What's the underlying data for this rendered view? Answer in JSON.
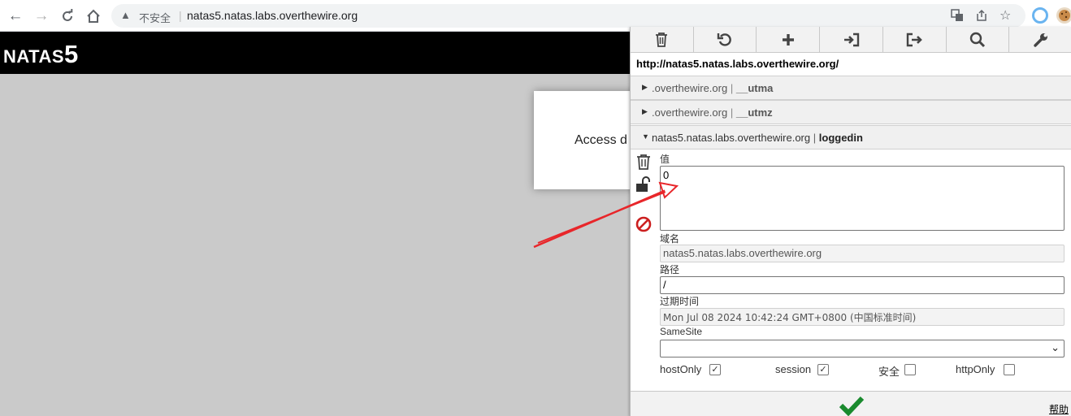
{
  "browser": {
    "security_label": "不安全",
    "url": "natas5.natas.labs.overthewire.org",
    "icons": [
      "back-icon",
      "forward-icon",
      "reload-icon",
      "home-icon",
      "warning-icon",
      "translate-icon",
      "share-icon",
      "star-icon",
      "extension-icon",
      "cookie-icon"
    ]
  },
  "page": {
    "title_prefix": "NATAS",
    "title_number": "5",
    "content_text": "Access d"
  },
  "cookie_editor": {
    "toolbar_icons": [
      "trash-icon",
      "undo-icon",
      "plus-icon",
      "import-icon",
      "export-icon",
      "search-icon",
      "wrench-icon"
    ],
    "current_url": "http://natas5.natas.labs.overthewire.org/",
    "cookies": [
      {
        "domain": ".overthewire.org",
        "sep": "|",
        "name": "__utma",
        "expanded": false
      },
      {
        "domain": ".overthewire.org",
        "sep": "|",
        "name": "__utmz",
        "expanded": false
      },
      {
        "domain": "natas5.natas.labs.overthewire.org",
        "sep": "|",
        "name": "loggedin",
        "expanded": true
      }
    ],
    "editor": {
      "value_label": "值",
      "value": "0",
      "domain_label": "域名",
      "domain": "natas5.natas.labs.overthewire.org",
      "path_label": "路径",
      "path": "/",
      "expires_label": "过期时间",
      "expires": "Mon Jul 08 2024 10:42:24 GMT+0800 (中国标准时间)",
      "samesite_label": "SameSite",
      "samesite": "",
      "flags": [
        {
          "label": "hostOnly",
          "checked": true
        },
        {
          "label": "session",
          "checked": true
        },
        {
          "label": "安全",
          "checked": false
        },
        {
          "label": "httpOnly",
          "checked": false
        }
      ]
    },
    "help_link": "帮助"
  },
  "colors": {
    "annotation_arrow": "#e8262a",
    "save_check": "#1a8a2e",
    "block_icon": "#cc1f1f"
  }
}
